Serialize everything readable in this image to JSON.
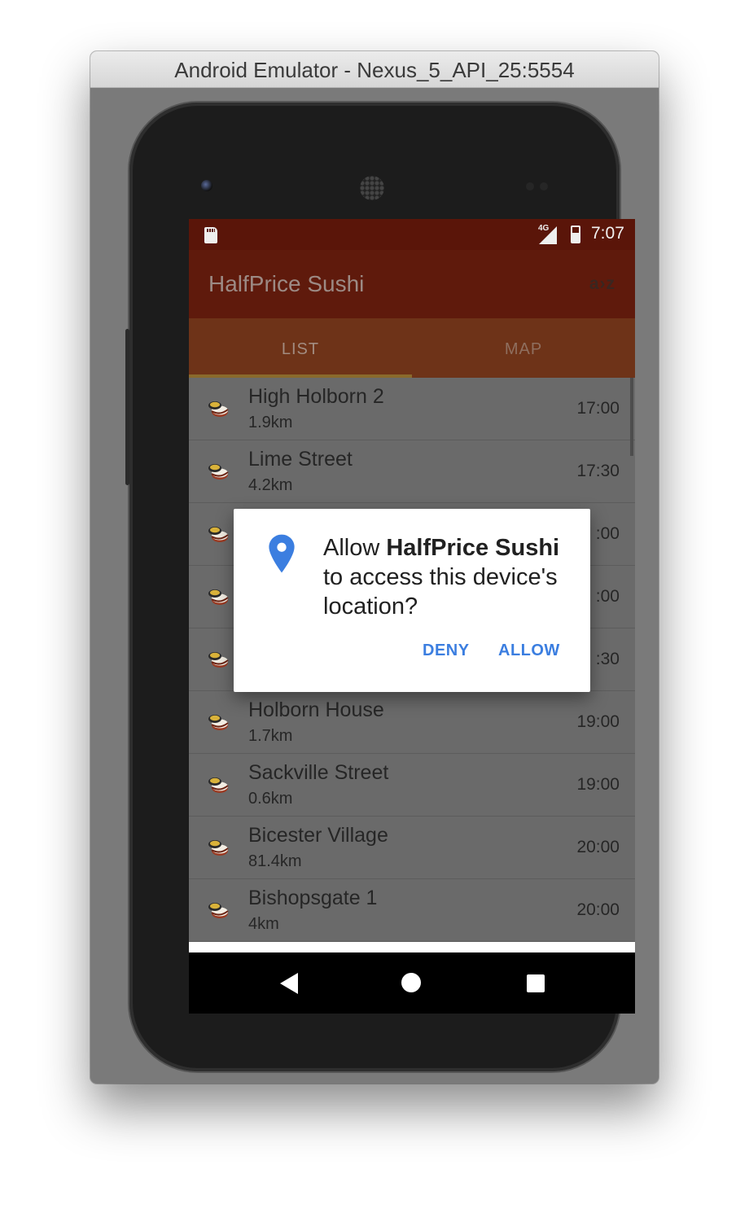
{
  "window": {
    "title": "Android Emulator - Nexus_5_API_25:5554"
  },
  "statusbar": {
    "network": "4G",
    "time": "7:07"
  },
  "app": {
    "title": "HalfPrice Sushi",
    "sort_icon_text": "a›z"
  },
  "tabs": [
    {
      "label": "LIST",
      "selected": true
    },
    {
      "label": "MAP",
      "selected": false
    }
  ],
  "list": [
    {
      "name": "High Holborn 2",
      "distance": "1.9km",
      "time": "17:00"
    },
    {
      "name": "Lime Street",
      "distance": "4.2km",
      "time": "17:30"
    },
    {
      "name": "",
      "distance": "",
      "time": ":00"
    },
    {
      "name": "",
      "distance": "",
      "time": ":00"
    },
    {
      "name": "",
      "distance": "",
      "time": ":30"
    },
    {
      "name": "Holborn House",
      "distance": "1.7km",
      "time": "19:00"
    },
    {
      "name": "Sackville Street",
      "distance": "0.6km",
      "time": "19:00"
    },
    {
      "name": "Bicester Village",
      "distance": "81.4km",
      "time": "20:00"
    },
    {
      "name": "Bishopsgate 1",
      "distance": "4km",
      "time": "20:00"
    }
  ],
  "dialog": {
    "prefix": "Allow ",
    "app_name": "HalfPrice Sushi",
    "suffix": " to access this device's location?",
    "deny_label": "DENY",
    "allow_label": "ALLOW",
    "icon": "location-pin-icon",
    "accent_color": "#3b7ee0"
  },
  "colors": {
    "status_bar": "#5a1509",
    "app_bar": "#5f1a0c",
    "tab_bar": "#6e3318"
  },
  "navbar": {
    "icons": [
      "back-icon",
      "home-icon",
      "recent-apps-icon"
    ]
  }
}
